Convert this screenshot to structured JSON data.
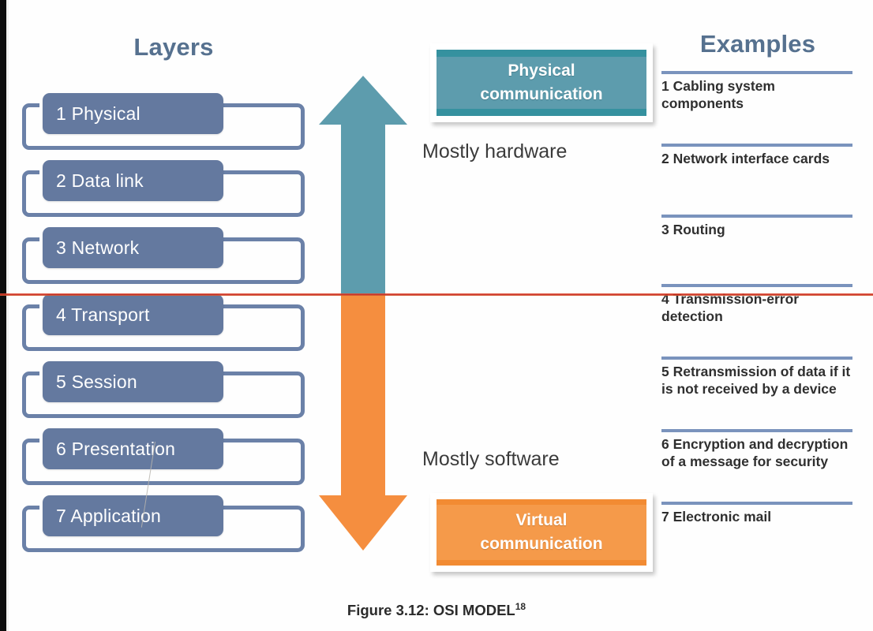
{
  "figure": {
    "caption_text": "Figure 3.12: OSI MODEL",
    "caption_ref": "18"
  },
  "columns": {
    "layers_heading": "Layers",
    "examples_heading": "Examples"
  },
  "layers": [
    {
      "number": "1",
      "name": "Physical",
      "label": "1 Physical"
    },
    {
      "number": "2",
      "name": "Data link",
      "label": "2 Data link"
    },
    {
      "number": "3",
      "name": "Network",
      "label": "3 Network"
    },
    {
      "number": "4",
      "name": "Transport",
      "label": "4 Transport"
    },
    {
      "number": "5",
      "name": "Session",
      "label": "5 Session"
    },
    {
      "number": "6",
      "name": "Presentation",
      "label": "6 Presentation"
    },
    {
      "number": "7",
      "name": "Application",
      "label": "7 Application"
    }
  ],
  "examples": [
    {
      "number": "1",
      "text": "1 Cabling system components"
    },
    {
      "number": "2",
      "text": "2 Network interface cards"
    },
    {
      "number": "3",
      "text": "3 Routing"
    },
    {
      "number": "4",
      "text": "4 Transmission-error detection"
    },
    {
      "number": "5",
      "text": "5 Retransmission of data if it is not received by a device"
    },
    {
      "number": "6",
      "text": "6 Encryption and decryption of a message for security"
    },
    {
      "number": "7",
      "text": "7 Electronic mail"
    }
  ],
  "center": {
    "up_arrow_name": "physical-communication-arrow",
    "down_arrow_name": "virtual-communication-arrow",
    "physical_box_line1": "Physical",
    "physical_box_line2": "communication",
    "virtual_box_line1": "Virtual",
    "virtual_box_line2": "communication",
    "mostly_hardware": "Mostly hardware",
    "mostly_software": "Mostly software"
  },
  "colors": {
    "layer_chip": "#64799f",
    "layer_outline": "#6b81a8",
    "heading_blue": "#56718f",
    "teal": "#5d9cad",
    "teal_band": "#35919f",
    "orange": "#f59a4a",
    "orange_band": "#f28b33",
    "example_rule": "#7a93bd",
    "red_rule": "#c62020"
  }
}
